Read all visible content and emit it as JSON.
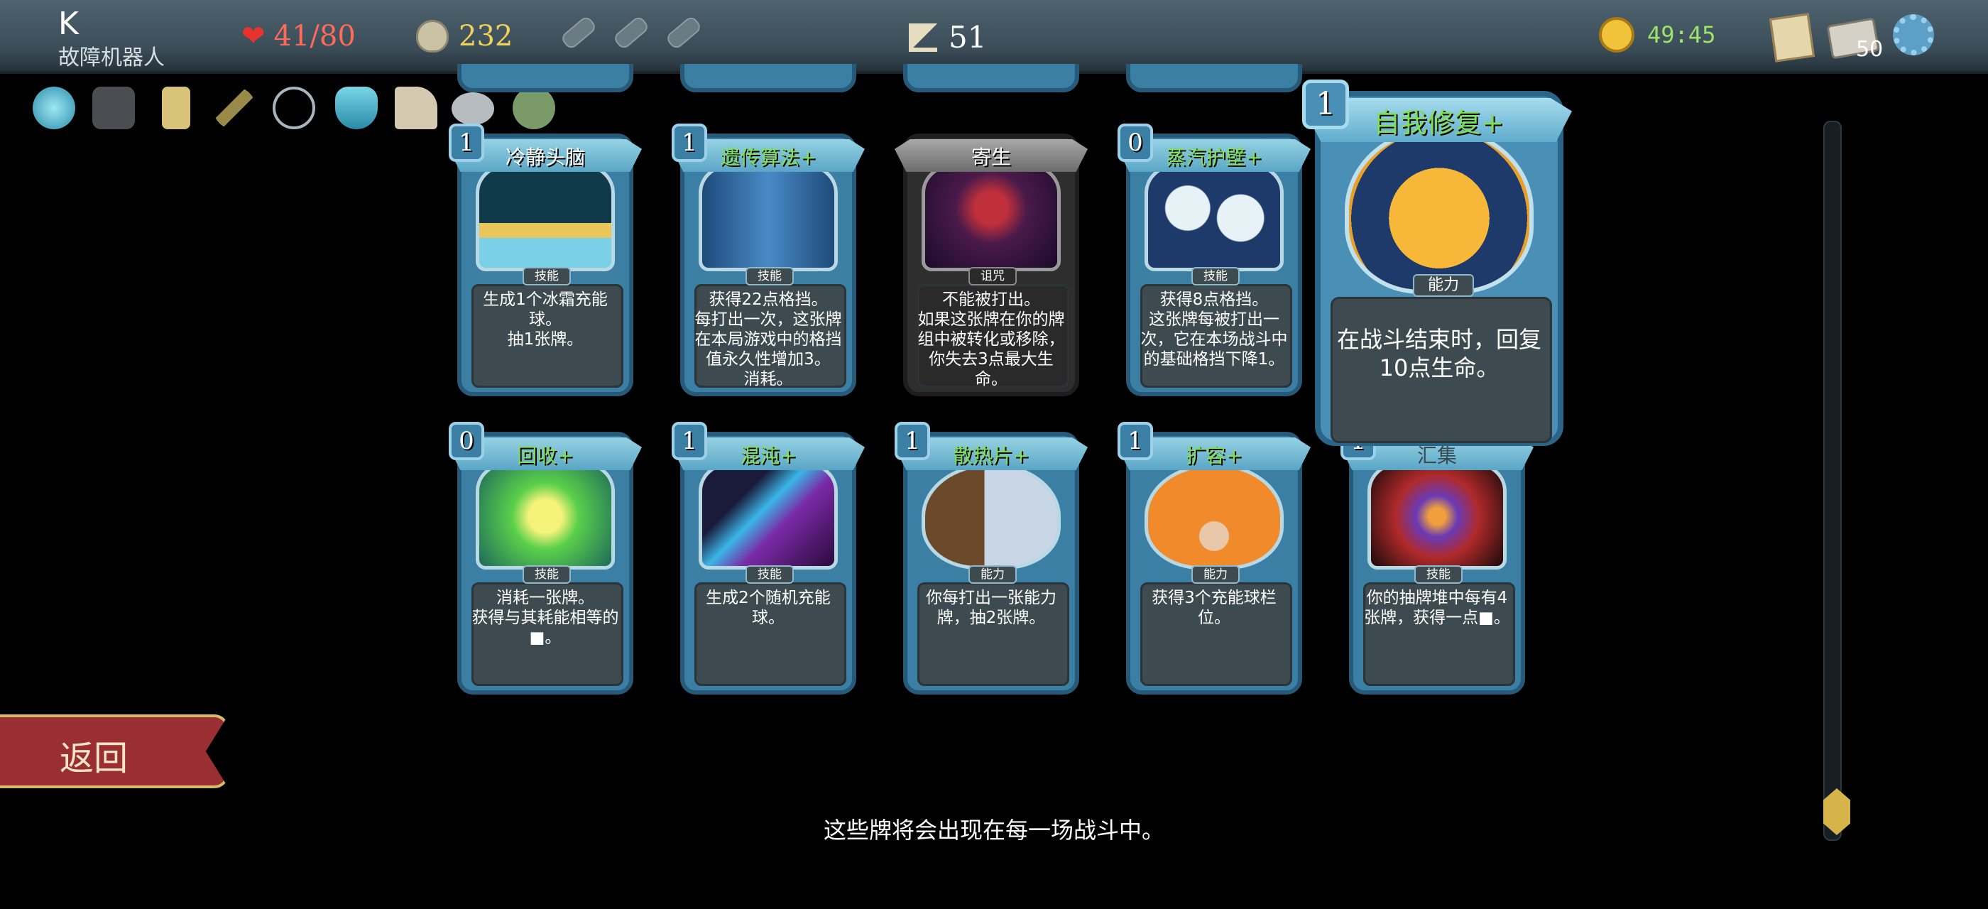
{
  "topbar": {
    "player_name": "K",
    "character_class": "故障机器人",
    "hp": "41/80",
    "gold": "232",
    "floor": "51",
    "timer": "49:45",
    "deck_count": "50"
  },
  "cards_row1": [
    {
      "cost": "1",
      "name": "冷静头脑",
      "type": "技能",
      "upgraded": false,
      "desc": "生成1个冰霜充能球。\n抽1张牌。"
    },
    {
      "cost": "1",
      "name": "遗传算法+",
      "type": "技能",
      "upgraded": true,
      "desc": "获得22点格挡。\n每打出一次，这张牌在本局游戏中的格挡值永久性增加3。\n消耗。"
    },
    {
      "cost": "",
      "name": "寄生",
      "type": "诅咒",
      "upgraded": false,
      "desc": "不能被打出。\n如果这张牌在你的牌组中被转化或移除，你失去3点最大生命。"
    },
    {
      "cost": "0",
      "name": "蒸汽护壁+",
      "type": "技能",
      "upgraded": true,
      "desc": "获得8点格挡。\n这张牌每被打出一次，它在本场战斗中的基础格挡下降1。"
    }
  ],
  "cards_row2": [
    {
      "cost": "0",
      "name": "回收+",
      "type": "技能",
      "upgraded": true,
      "desc": "消耗一张牌。\n获得与其耗能相等的\n■。"
    },
    {
      "cost": "1",
      "name": "混沌+",
      "type": "技能",
      "upgraded": true,
      "desc": "生成2个随机充能球。"
    },
    {
      "cost": "1",
      "name": "散热片+",
      "type": "能力",
      "upgraded": true,
      "desc": "你每打出一张能力牌，抽2张牌。"
    },
    {
      "cost": "1",
      "name": "扩容+",
      "type": "能力",
      "upgraded": true,
      "desc": "获得3个充能球栏位。"
    },
    {
      "cost": "1",
      "name": "汇集",
      "type": "技能",
      "upgraded": false,
      "desc": "你的抽牌堆中每有4张牌，获得一点■。"
    }
  ],
  "hovered_card": {
    "cost": "1",
    "name": "自我修复+",
    "type": "能力",
    "desc": "在战斗结束时，回复10点生命。"
  },
  "back_button": "返回",
  "footer_text": "这些牌将会出现在每一场战斗中。",
  "colors": {
    "accent_green": "#7ee05a",
    "hp_red": "#ff6a5a",
    "gold": "#f2d25a",
    "card_blue": "#3c7fa4"
  }
}
